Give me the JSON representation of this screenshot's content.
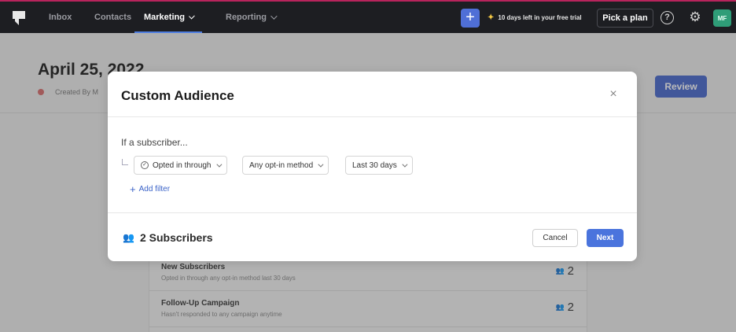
{
  "topnav": {
    "items": [
      {
        "label": "Inbox"
      },
      {
        "label": "Contacts"
      },
      {
        "label": "Marketing"
      },
      {
        "label": "Reporting"
      }
    ],
    "trial_text": "10 days left in your free trial",
    "plan_button": "Pick a plan",
    "avatar_initials": "MF"
  },
  "page": {
    "title": "April 25, 2022",
    "meta": "Created By M",
    "review_button": "Review"
  },
  "segments": [
    {
      "name": "New Subscribers",
      "description": "Opted in through any opt-in method last 30 days",
      "count": "2"
    },
    {
      "name": "Follow-Up Campaign",
      "description": "Hasn't responded to any campaign anytime",
      "count": "2"
    }
  ],
  "modal": {
    "title": "Custom Audience",
    "condition_label": "If a subscriber...",
    "filters": {
      "action": "Opted in through",
      "method": "Any opt-in method",
      "period": "Last 30 days"
    },
    "add_filter": "Add filter",
    "subscriber_count": "2 Subscribers",
    "cancel": "Cancel",
    "next": "Next"
  },
  "colors": {
    "accent": "#4a74dd",
    "nav_bg": "#1d1e22",
    "avatar_bg": "#2f9d78"
  }
}
